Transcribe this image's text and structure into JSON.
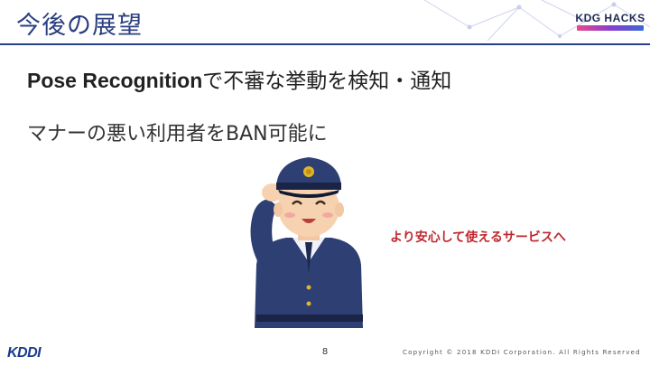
{
  "slide": {
    "title": "今後の展望",
    "logo_text": "KDG HACKS",
    "bullets": {
      "first_bold": "Pose Recognition",
      "first_rest": "で不審な挙動を検知・通知",
      "second": "マナーの悪い利用者をBAN可能に"
    },
    "callout": "より安心して使えるサービスへ",
    "page_number": "8",
    "copyright": "Copyright © 2018 KDDI Corporation. All Rights Reserved",
    "footer_logo": "KDDI"
  },
  "colors": {
    "title": "#2b3f7f",
    "header_rule": "#26418c",
    "callout": "#c0282e",
    "uniform": "#2d3f73"
  },
  "icons": {
    "illustration": "police-officer-saluting"
  }
}
